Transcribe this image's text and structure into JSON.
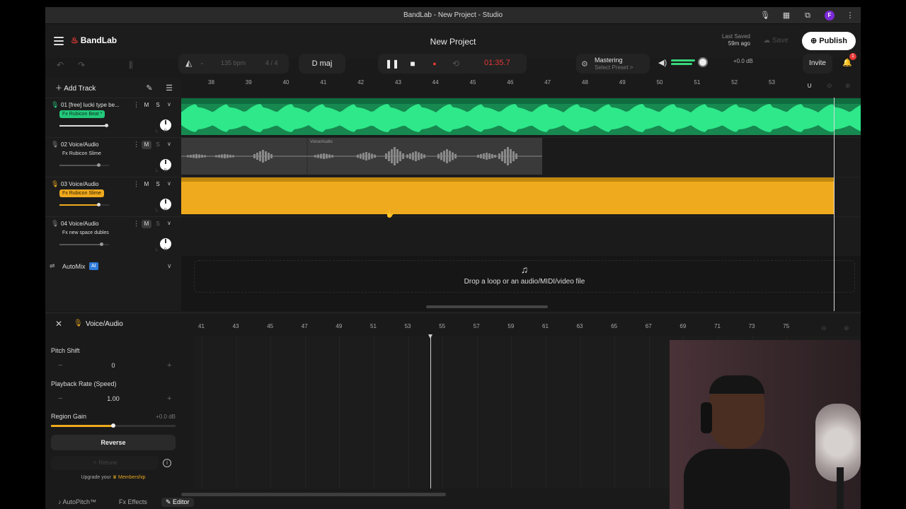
{
  "browser": {
    "title": "BandLab - New Project - Studio",
    "profile_initial": "F"
  },
  "header": {
    "logo": "BandLab",
    "project_title": "New Project",
    "last_saved_label": "Last Saved",
    "last_saved_value": "59m ago",
    "save_label": "Save",
    "publish_label": "Publish"
  },
  "transport": {
    "bpm": "135 bpm",
    "time_signature": "4 / 4",
    "key": "D maj",
    "time": "01:35.7",
    "mastering_title": "Mastering",
    "mastering_sub": "Select Preset >",
    "volume_db": "+0.0 dB",
    "volume_level": 0.73,
    "invite_label": "Invite",
    "notification_count": "1"
  },
  "arrange": {
    "add_track_label": "Add Track",
    "ruler_ticks": [
      "38",
      "39",
      "40",
      "41",
      "42",
      "43",
      "44",
      "45",
      "46",
      "47",
      "48",
      "49",
      "50",
      "51",
      "52",
      "53"
    ],
    "tracks": [
      {
        "number": "01",
        "name": "[free] lucki type be...",
        "fx": "Fx Rubicon Beat *",
        "fx_color": "#22c97b",
        "mute": "M",
        "solo": "S",
        "volume": 0.93
      },
      {
        "number": "02",
        "name": "Voice/Audio",
        "fx": "Fx Rubicon Slime",
        "fx_color": "",
        "mute": "M",
        "solo": "S",
        "volume": 0.77
      },
      {
        "number": "03",
        "name": "Voice/Audio",
        "fx": "Fx Rubicon Slime",
        "fx_color": "#efaa1d",
        "mute": "M",
        "solo": "S",
        "volume": 0.77
      },
      {
        "number": "04",
        "name": "Voice/Audio",
        "fx": "Fx new space dubles",
        "fx_color": "",
        "mute": "M",
        "solo": "S",
        "volume": 0.83
      }
    ],
    "gray_region_label": "Voice/Audio",
    "automix_label": "AutoMix",
    "ai_badge": "AI",
    "drop_text": "Drop a loop or an audio/MIDI/video file"
  },
  "editor": {
    "title": "Voice/Audio",
    "pitch_shift_label": "Pitch Shift",
    "pitch_shift_value": "0",
    "playback_rate_label": "Playback Rate (Speed)",
    "playback_rate_value": "1.00",
    "region_gain_label": "Region Gain",
    "region_gain_value": "+0.0 dB",
    "reverse_label": "Reverse",
    "retune_label": "Retune",
    "upgrade_text": "Upgrade your",
    "membership_label": "Membership",
    "ruler_ticks": [
      "41",
      "43",
      "45",
      "47",
      "49",
      "51",
      "53",
      "55",
      "57",
      "59",
      "61",
      "63",
      "65",
      "67",
      "69",
      "71",
      "73",
      "75"
    ]
  },
  "bottom_tabs": {
    "autopitch": "AutoPitch™",
    "effects": "Effects",
    "editor": "Editor"
  },
  "colors": {
    "accent_green": "#22c97b",
    "accent_yellow": "#efaa1d",
    "record_red": "#e53935"
  }
}
